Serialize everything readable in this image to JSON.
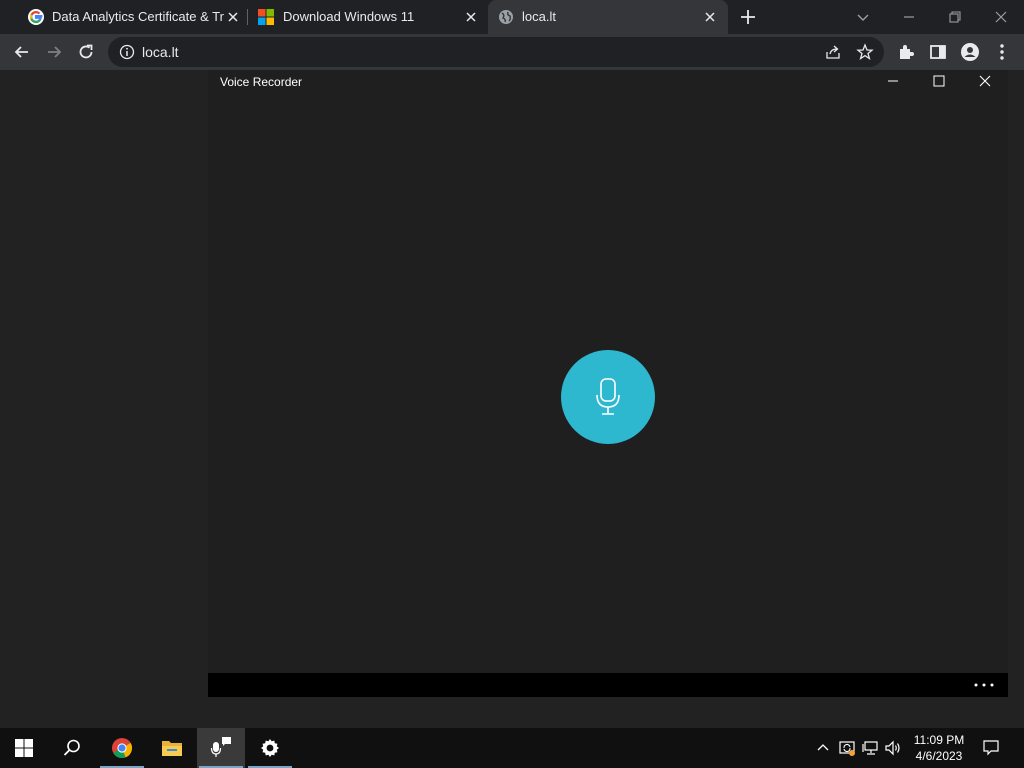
{
  "browser": {
    "tabs": [
      {
        "title": "Data Analytics Certificate & Trainin",
        "favicon": "google-icon"
      },
      {
        "title": "Download Windows 11",
        "favicon": "microsoft-icon"
      },
      {
        "title": "loca.lt",
        "favicon": "globe-icon",
        "active": true
      }
    ],
    "address": "loca.lt"
  },
  "app": {
    "title": "Voice Recorder",
    "record_button_icon": "microphone-icon",
    "accent": "#2eb8cf"
  },
  "taskbar": {
    "time": "11:09 PM",
    "date": "4/6/2023"
  }
}
